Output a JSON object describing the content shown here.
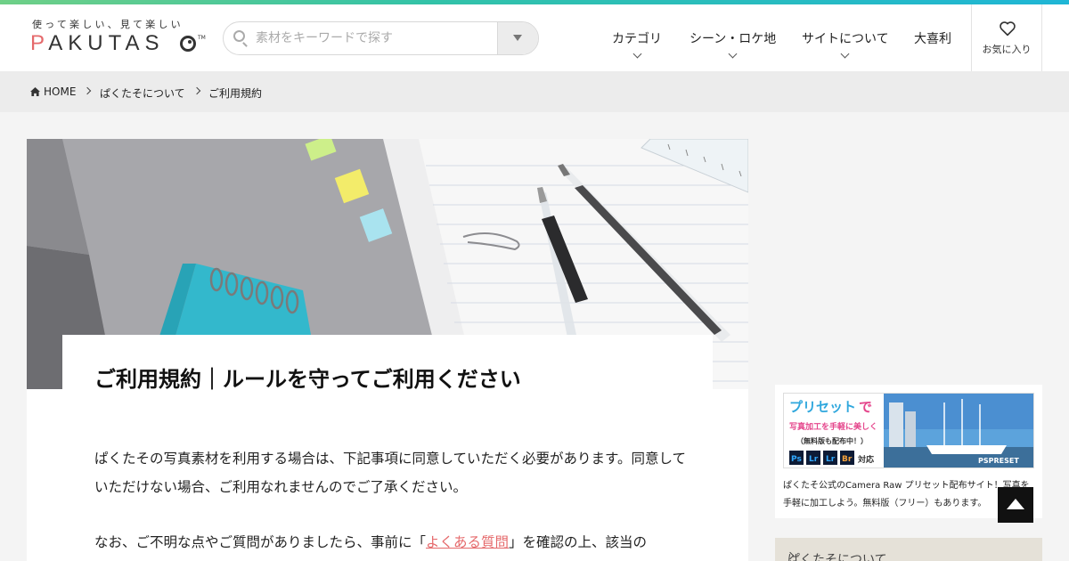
{
  "header": {
    "tagline": "使って楽しい、見て楽しい",
    "logo_text": "PAKUTAS",
    "logo_tm": "TM",
    "search": {
      "placeholder": "素材をキーワードで探す"
    },
    "nav": [
      {
        "label": "カテゴリ",
        "has_dropdown": true
      },
      {
        "label": "シーン・ロケ地",
        "has_dropdown": true
      },
      {
        "label": "サイトについて",
        "has_dropdown": true
      },
      {
        "label": "大喜利",
        "has_dropdown": false
      }
    ],
    "favorites_label": "お気に入り"
  },
  "breadcrumb": {
    "items": [
      "HOME",
      "ぱくたそについて",
      "ご利用規約"
    ]
  },
  "article": {
    "title": "ご利用規約｜ルールを守ってご利用ください",
    "paragraph1": "ぱくたその写真素材を利用する場合は、下記事項に同意していただく必要があります。同意していただけない場合、ご利用なれませんのでご了承ください。",
    "paragraph2_before": "なお、ご不明な点やご質問がありましたら、事前に「",
    "paragraph2_link": "よくある質問",
    "paragraph2_after": "」を確認の上、該当の"
  },
  "sidebar": {
    "ad": {
      "banner_headline_1": "プリセット",
      "banner_headline_2": "で",
      "banner_sub": "写真加工を手軽に美しく",
      "banner_note": "（無料版も配布中！）",
      "banner_badges": [
        "Ps",
        "Lr",
        "Lr",
        "Br"
      ],
      "banner_badges_suffix": "対応",
      "banner_brand": "PSPRESET",
      "caption": "ぱくたそ公式のCamera Raw プリセット配布サイト！写真を手軽に加工しよう。無料版（フリー）もあります。"
    },
    "section_heading": "ぱくたそについて"
  },
  "colors": {
    "accent": "#e5696b",
    "gradient_start": "#6fd087",
    "gradient_end": "#1fb6d6",
    "page_bg": "#f4f4f4"
  }
}
